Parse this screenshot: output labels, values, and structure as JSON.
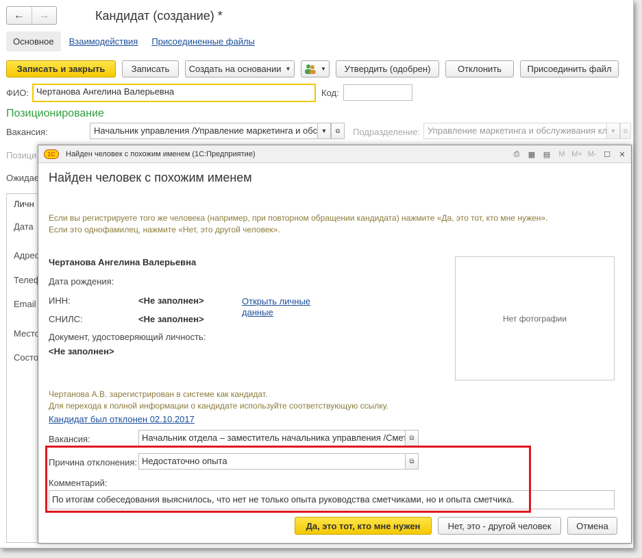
{
  "form": {
    "title": "Кандидат (создание) *",
    "nav": {
      "back": "←",
      "forward": "→"
    },
    "tabs": [
      "Основное",
      "Взаимодействия",
      "Присоединенные файлы"
    ],
    "toolbar": {
      "save_close": "Записать и закрыть",
      "save": "Записать",
      "create_based": "Создать на основании",
      "approve": "Утвердить (одобрен)",
      "reject": "Отклонить",
      "attach": "Присоединить файл"
    },
    "fio_label": "ФИО:",
    "fio_value": "Чертанова Ангелина Валерьевна",
    "code_label": "Код:",
    "code_value": "",
    "section_positioning": "Позиционирование",
    "vacancy_label": "Вакансия:",
    "vacancy_value": "Начальник управления /Управление маркетинга и обс.",
    "division_label": "Подразделение:",
    "division_value": "Управление маркетинга и обслуживания кли",
    "partial_labels": [
      "Позици",
      "Ожидае"
    ],
    "left_tab_label": "Личн",
    "left_labels": [
      "Дата",
      "Адрес",
      "Телеф",
      "Email",
      "Место",
      "Состо"
    ]
  },
  "dialog": {
    "caption": "Найден человек с похожим именем  (1С:Предприятие)",
    "logo": "1С",
    "heading": "Найден человек с похожим именем",
    "info_line1": "Если вы регистрируете того же человека (например, при повторном обращении кандидата) нажмите «Да, это тот, кто мне нужен».",
    "info_line2": "Если это однофамилец, нажмите «Нет, это другой человек».",
    "person_name": "Чертанова Ангелина Валерьевна",
    "birth_label": "Дата рождения:",
    "inn_label": "ИНН:",
    "inn_value": "<Не заполнен>",
    "snils_label": "СНИЛС:",
    "snils_value": "<Не заполнен>",
    "open_personal_line1": "Открыть личные",
    "open_personal_line2": "данные",
    "doc_label": "Документ, удостоверяющий личность:",
    "doc_value": "<Не заполнен>",
    "photo_text": "Нет фотографии",
    "registered_line1": "Чертанова А.В. зарегистрирован в системе как кандидат.",
    "registered_line2": "Для перехода к полной информации о кандидате используйте соответствующую ссылку.",
    "rejected_link": "Кандидат был отклонен 02.10.2017",
    "vacancy_label": "Вакансия:",
    "vacancy_value": "Начальник отдела – заместитель начальника управления /Смет",
    "reason_label": "Причина отклонения:",
    "reason_value": "Недостаточно опыта",
    "comment_label": "Комментарий:",
    "comment_value": "По итогам собеседования выяснилось, что нет не только опыта руководства сметчиками, но и опыта сметчика.",
    "btn_yes": "Да, это тот, кто мне нужен",
    "btn_no": "Нет, это - другой человек",
    "btn_cancel": "Отмена",
    "titlebar_m_labels": [
      "M",
      "M+",
      "M-"
    ]
  }
}
